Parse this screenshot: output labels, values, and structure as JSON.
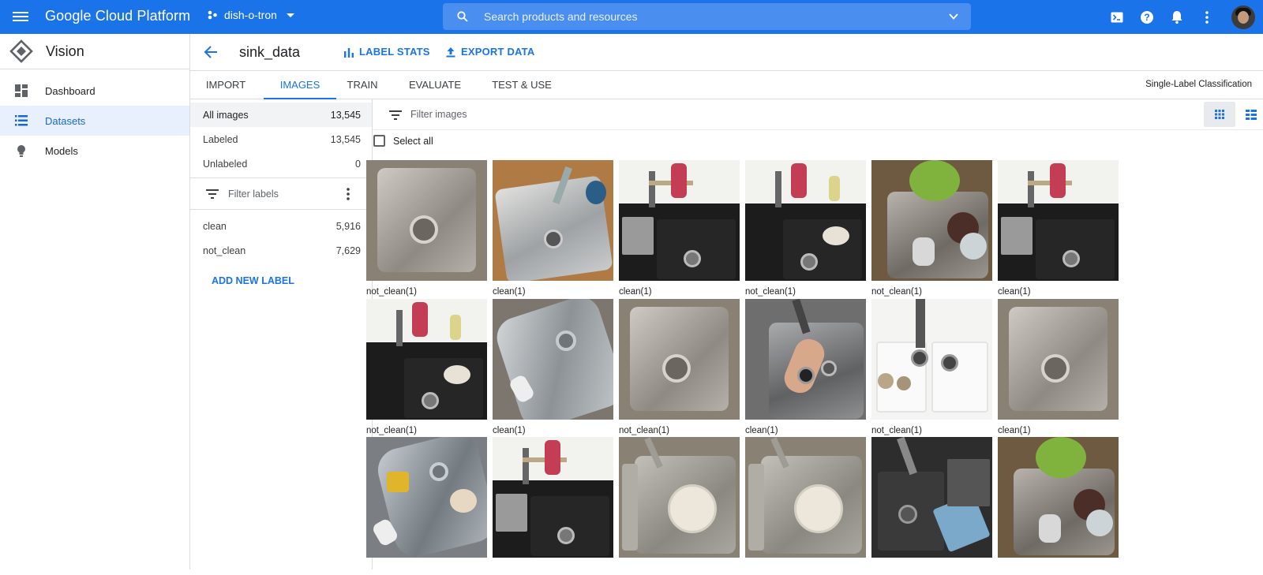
{
  "topbar": {
    "brand": "Google Cloud Platform",
    "project": "dish-o-tron",
    "search_placeholder": "Search products and resources",
    "icons": [
      "cloud-shell-icon",
      "help-icon",
      "notifications-icon",
      "more-vert-icon"
    ]
  },
  "nav": {
    "product": "Vision",
    "items": [
      {
        "label": "Dashboard",
        "icon": "dashboard-icon",
        "active": false
      },
      {
        "label": "Datasets",
        "icon": "list-icon",
        "active": true
      },
      {
        "label": "Models",
        "icon": "lightbulb-icon",
        "active": false
      }
    ]
  },
  "header": {
    "dataset_name": "sink_data",
    "label_stats": "LABEL STATS",
    "export_data": "EXPORT DATA"
  },
  "tabs": {
    "items": [
      "IMPORT",
      "IMAGES",
      "TRAIN",
      "EVALUATE",
      "TEST & USE"
    ],
    "active": "IMAGES",
    "classification": "Single-Label Classification"
  },
  "filters": {
    "counts": [
      {
        "label": "All images",
        "count": "13,545"
      },
      {
        "label": "Labeled",
        "count": "13,545"
      },
      {
        "label": "Unlabeled",
        "count": "0"
      }
    ],
    "filter_labels_placeholder": "Filter labels",
    "labels": [
      {
        "label": "clean",
        "count": "5,916"
      },
      {
        "label": "not_clean",
        "count": "7,629"
      }
    ],
    "add_new_label": "ADD NEW LABEL"
  },
  "main": {
    "filter_images_placeholder": "Filter images",
    "select_all": "Select all",
    "images": [
      {
        "caption": "not_clean(1)",
        "style": "steel-granite"
      },
      {
        "caption": "clean(1)",
        "style": "steel-wood"
      },
      {
        "caption": "clean(1)",
        "style": "black-sink"
      },
      {
        "caption": "not_clean(1)",
        "style": "black-sink-bowl"
      },
      {
        "caption": "not_clean(1)",
        "style": "steel-green-cloth"
      },
      {
        "caption": "clean(1)",
        "style": "black-sink"
      },
      {
        "caption": "not_clean(1)",
        "style": "black-sink-bowl"
      },
      {
        "caption": "clean(1)",
        "style": "steel-angle"
      },
      {
        "caption": "not_clean(1)",
        "style": "steel-granite"
      },
      {
        "caption": "clean(1)",
        "style": "steel-hand"
      },
      {
        "caption": "not_clean(1)",
        "style": "white-sink"
      },
      {
        "caption": "clean(1)",
        "style": "steel-granite"
      },
      {
        "caption": "",
        "style": "steel-sponge"
      },
      {
        "caption": "",
        "style": "black-sink"
      },
      {
        "caption": "",
        "style": "steel-plate"
      },
      {
        "caption": "",
        "style": "steel-plate"
      },
      {
        "caption": "",
        "style": "black-sink-blue-cloth"
      },
      {
        "caption": "",
        "style": "steel-green-cloth"
      }
    ]
  }
}
